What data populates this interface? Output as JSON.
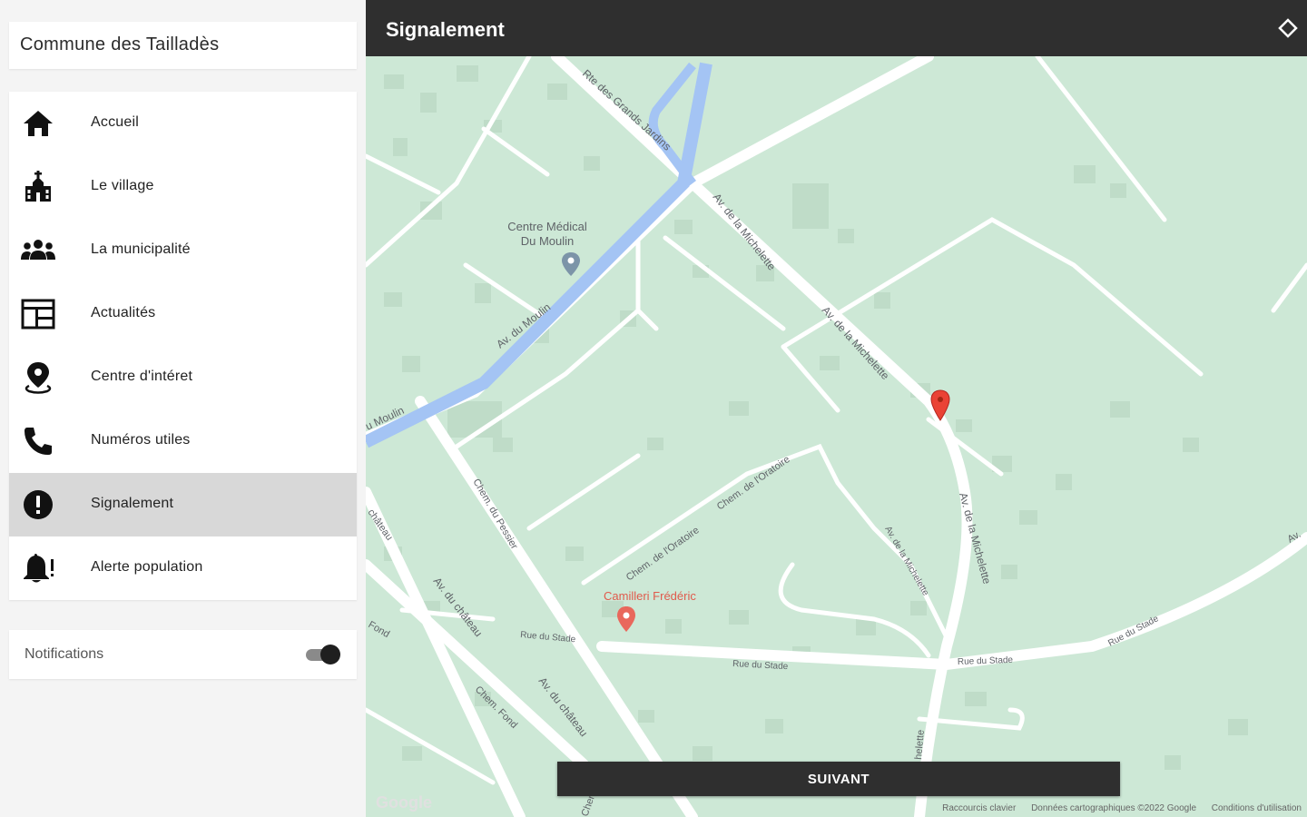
{
  "sidebar": {
    "commune_title": "Commune des Tailladès",
    "menu": [
      {
        "label": "Accueil",
        "icon": "home-icon"
      },
      {
        "label": "Le village",
        "icon": "church-icon"
      },
      {
        "label": "La municipalité",
        "icon": "group-icon"
      },
      {
        "label": "Actualités",
        "icon": "news-icon"
      },
      {
        "label": "Centre d'intéret",
        "icon": "location-pin-icon"
      },
      {
        "label": "Numéros utiles",
        "icon": "phone-icon"
      },
      {
        "label": "Signalement",
        "icon": "alert-icon",
        "active": true
      },
      {
        "label": "Alerte population",
        "icon": "bell-alert-icon"
      }
    ],
    "notifications": {
      "label": "Notifications",
      "enabled": true
    }
  },
  "header": {
    "title": "Signalement",
    "locate_icon": "diamond-locate-icon"
  },
  "map": {
    "streets": {
      "grands_jardins": "Rte des Grands Jardins",
      "michelette_1": "Av. de la Michelette",
      "michelette_2": "Av. de la Michelette",
      "michelette_3": "Av. de la Michelette",
      "michelette_side": "Av. de la Michelette",
      "moulin_1": "Av. du Moulin",
      "moulin_2": "u Moulin",
      "pessier": "Chem. du Pessier",
      "oratoire_1": "Chem. de l'Oratoire",
      "oratoire_2": "Chem. de l'Oratoire",
      "stade_1": "Rue du Stade",
      "stade_2": "Rue du Stade",
      "stade_3": "Rue du Stade",
      "stade_4": "Rue du Stade",
      "chateau_1": "Av. du château",
      "chateau_2": "Av. du château",
      "chateau_3": "château",
      "fond": "Chem. Fond",
      "fond_2": "Fond",
      "misc_right": "Av.",
      "misc_bottom": "Chemi",
      "misc_mich_bottom": "helette"
    },
    "poi_medical_1": "Centre Médical",
    "poi_medical_2": "Du Moulin",
    "poi_camilleri": "Camilleri Frédéric",
    "google_logo": "Google",
    "footer": {
      "shortcuts": "Raccourcis clavier",
      "data": "Données cartographiques ©2022 Google",
      "terms": "Conditions d'utilisation"
    }
  },
  "actions": {
    "next_label": "SUIVANT"
  },
  "colors": {
    "topbar": "#2f2f2f",
    "map_bg": "#cde8d6",
    "water": "#a4c4f4",
    "marker": "#ea4335",
    "active_item": "#d8d8d8"
  }
}
